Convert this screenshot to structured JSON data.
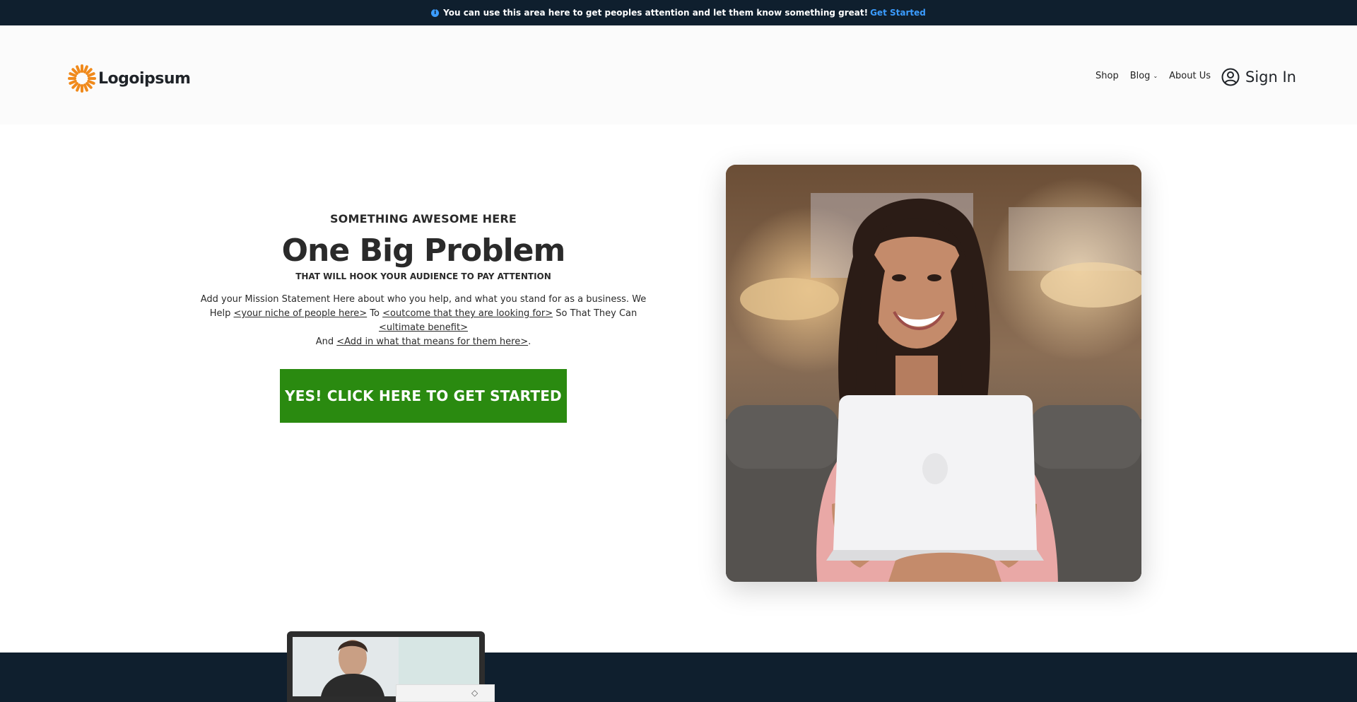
{
  "announcement": {
    "text": "You can use this area here to get peoples attention and let them know something great!",
    "link_label": "Get Started"
  },
  "header": {
    "logo_text": "Logoipsum",
    "nav": [
      {
        "label": "Shop"
      },
      {
        "label": "Blog"
      },
      {
        "label": "About Us"
      }
    ],
    "signin_label": "Sign In"
  },
  "hero": {
    "eyebrow": "SOMETHING AWESOME HERE",
    "headline": "One Big Problem",
    "subhead": "THAT WILL HOOK YOUR AUDIENCE TO PAY ATTENTION",
    "mission": {
      "part1": "Add your Mission Statement Here about who you help, and what you stand for as a business. We Help ",
      "niche": "<your niche of people here>",
      "part2": " To ",
      "outcome": "<outcome that they are looking for>",
      "part3": " So That They Can ",
      "benefit": "<ultimate benefit>",
      "part4": " And ",
      "meaning": "<Add in what that means for them here>",
      "part5": "."
    },
    "cta_label": "YES! CLICK HERE TO GET STARTED"
  },
  "colors": {
    "topbar_bg": "#0f1f2e",
    "link_blue": "#3b9cff",
    "cta_green": "#2a8a10",
    "logo_orange": "#f08a1c"
  },
  "icons": {
    "announcement": "info-icon",
    "logo": "sunburst-logo-icon",
    "blog_dropdown": "chevron-down-icon",
    "signin": "user-circle-icon"
  }
}
